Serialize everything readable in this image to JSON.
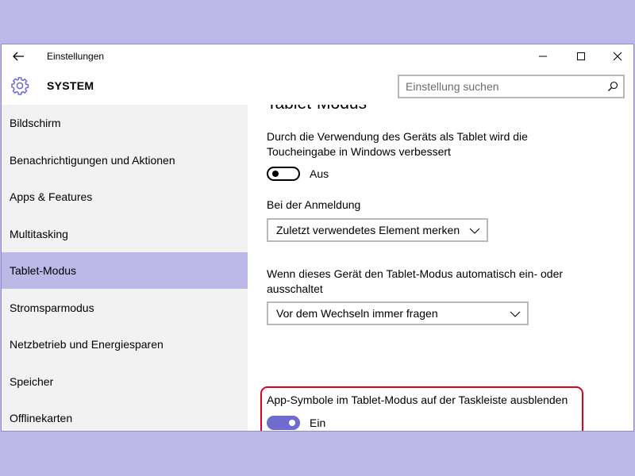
{
  "window": {
    "title": "Einstellungen"
  },
  "header": {
    "title": "SYSTEM",
    "search_placeholder": "Einstellung suchen"
  },
  "sidebar": {
    "items": [
      {
        "label": "Bildschirm",
        "active": false
      },
      {
        "label": "Benachrichtigungen und Aktionen",
        "active": false
      },
      {
        "label": "Apps & Features",
        "active": false
      },
      {
        "label": "Multitasking",
        "active": false
      },
      {
        "label": "Tablet-Modus",
        "active": true
      },
      {
        "label": "Stromsparmodus",
        "active": false
      },
      {
        "label": "Netzbetrieb und Energiesparen",
        "active": false
      },
      {
        "label": "Speicher",
        "active": false
      },
      {
        "label": "Offlinekarten",
        "active": false
      }
    ]
  },
  "main": {
    "section_title": "Tablet-Modus",
    "touch_description_line1": "Durch die Verwendung des Geräts als Tablet wird die",
    "touch_description_line2": "Toucheingabe in Windows verbessert",
    "touch_toggle": {
      "state": "off",
      "label": "Aus"
    },
    "signin_label": "Bei der Anmeldung",
    "signin_dropdown_value": "Zuletzt verwendetes Element merken",
    "auto_switch_label_line1": "Wenn dieses Gerät den Tablet-Modus automatisch ein- oder",
    "auto_switch_label_line2": "ausschaltet",
    "auto_switch_dropdown_value": "Vor dem Wechseln immer fragen",
    "hide_icons_label": "App-Symbole im Tablet-Modus auf der Taskleiste ausblenden",
    "hide_icons_toggle": {
      "state": "on",
      "label": "Ein"
    }
  },
  "colors": {
    "accent": "#6f6ccf",
    "selection": "#bcb9e8",
    "highlight_border": "#e0001e"
  }
}
